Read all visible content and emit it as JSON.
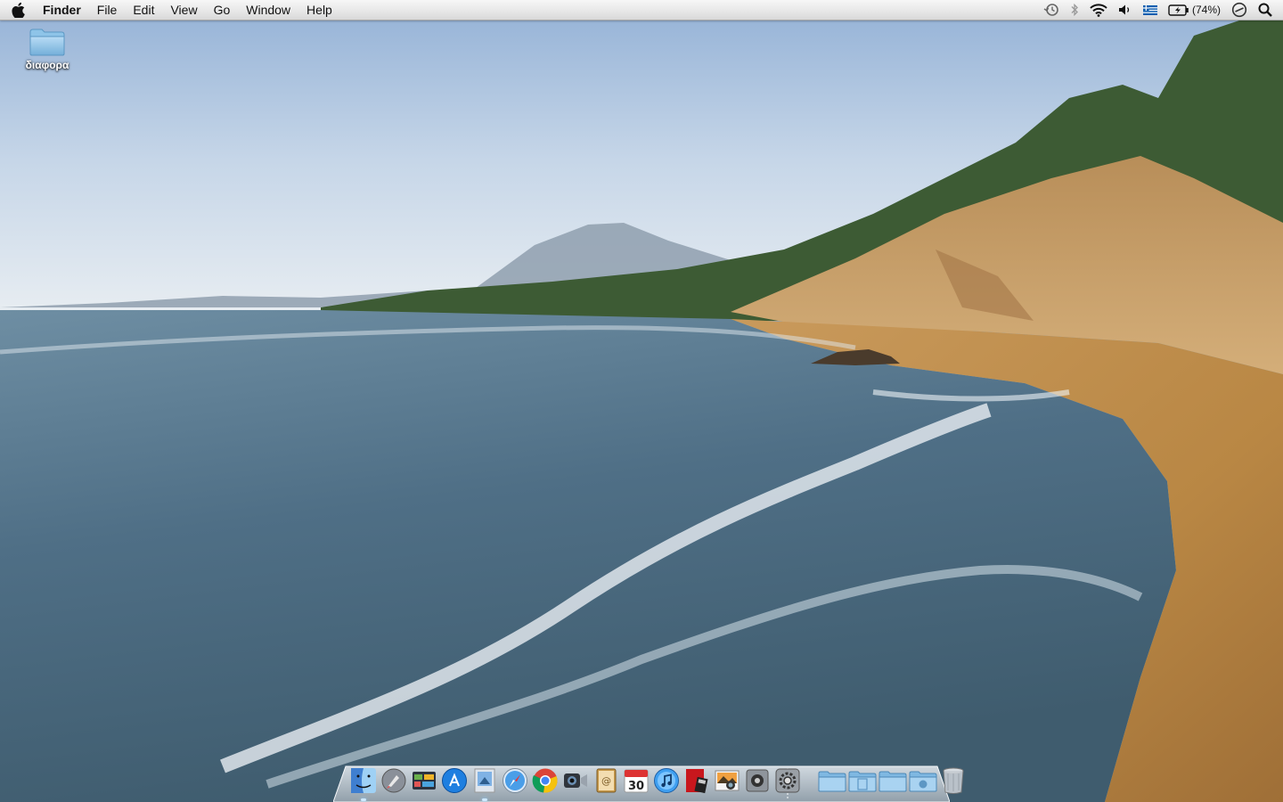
{
  "menubar": {
    "apple_icon": "apple-icon",
    "app_name": "Finder",
    "menus": [
      "File",
      "Edit",
      "View",
      "Go",
      "Window",
      "Help"
    ],
    "status": {
      "icons": [
        "time-machine-icon",
        "bluetooth-icon",
        "wifi-icon",
        "volume-icon",
        "greek-flag-input-icon",
        "battery-charging-icon",
        "clock-status-icon",
        "spotlight-search-icon"
      ],
      "battery_text": "(74%)"
    }
  },
  "desktop": {
    "folder_label": "διαφορα"
  },
  "dock": {
    "apps": [
      "finder-icon",
      "launchpad-icon",
      "mission-control-icon",
      "app-store-icon",
      "preview-icon",
      "safari-icon",
      "chrome-icon",
      "facetime-icon",
      "address-book-icon",
      "calendar-icon",
      "itunes-icon",
      "photo-booth-icon",
      "iphoto-icon",
      "camera-icon",
      "system-preferences-icon"
    ],
    "calendar_day": "30",
    "stacks": [
      "applications-folder-icon",
      "documents-folder-icon",
      "downloads-folder-icon",
      "shared-folder-icon",
      "trash-icon"
    ]
  }
}
